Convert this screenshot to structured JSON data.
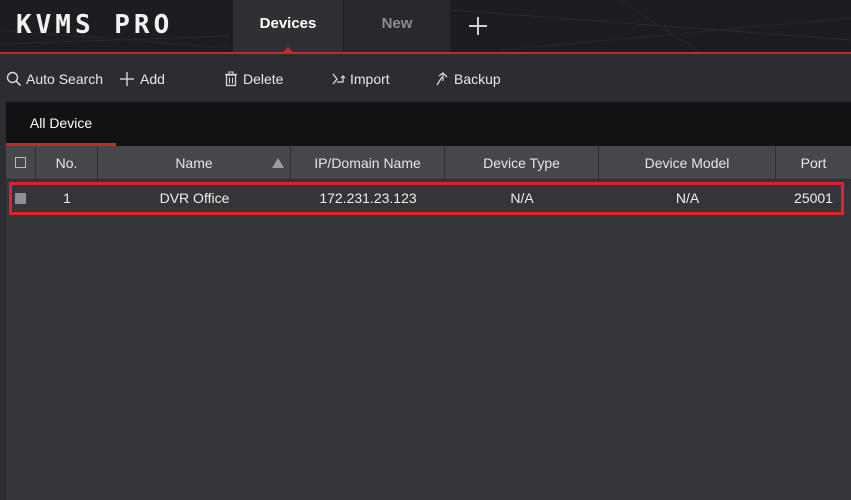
{
  "app": {
    "logo": "KVMS PRO"
  },
  "tabs": {
    "devices": "Devices",
    "new": "New"
  },
  "toolbar": {
    "auto_search": "Auto Search",
    "add": "Add",
    "delete": "Delete",
    "import": "Import",
    "backup": "Backup"
  },
  "panel": {
    "active_tab": "All Device"
  },
  "table": {
    "columns": {
      "no": "No.",
      "name": "Name",
      "ip": "IP/Domain Name",
      "type": "Device Type",
      "model": "Device Model",
      "port": "Port"
    },
    "rows": [
      {
        "no": "1",
        "name": "DVR Office",
        "ip": "172.231.23.123",
        "type": "N/A",
        "model": "N/A",
        "port": "25001"
      }
    ]
  },
  "colors": {
    "accent": "#c8272d",
    "highlight": "#e0222b",
    "titlebar": "#1c1d20",
    "background": "#2b2d30",
    "header": "#45474b"
  },
  "icons": {
    "auto_search": "search-icon",
    "add": "plus-icon",
    "delete": "trash-icon",
    "import": "import-icon",
    "backup": "backup-icon",
    "sort": "sort-ascending-icon",
    "new_tab": "plus-icon"
  }
}
